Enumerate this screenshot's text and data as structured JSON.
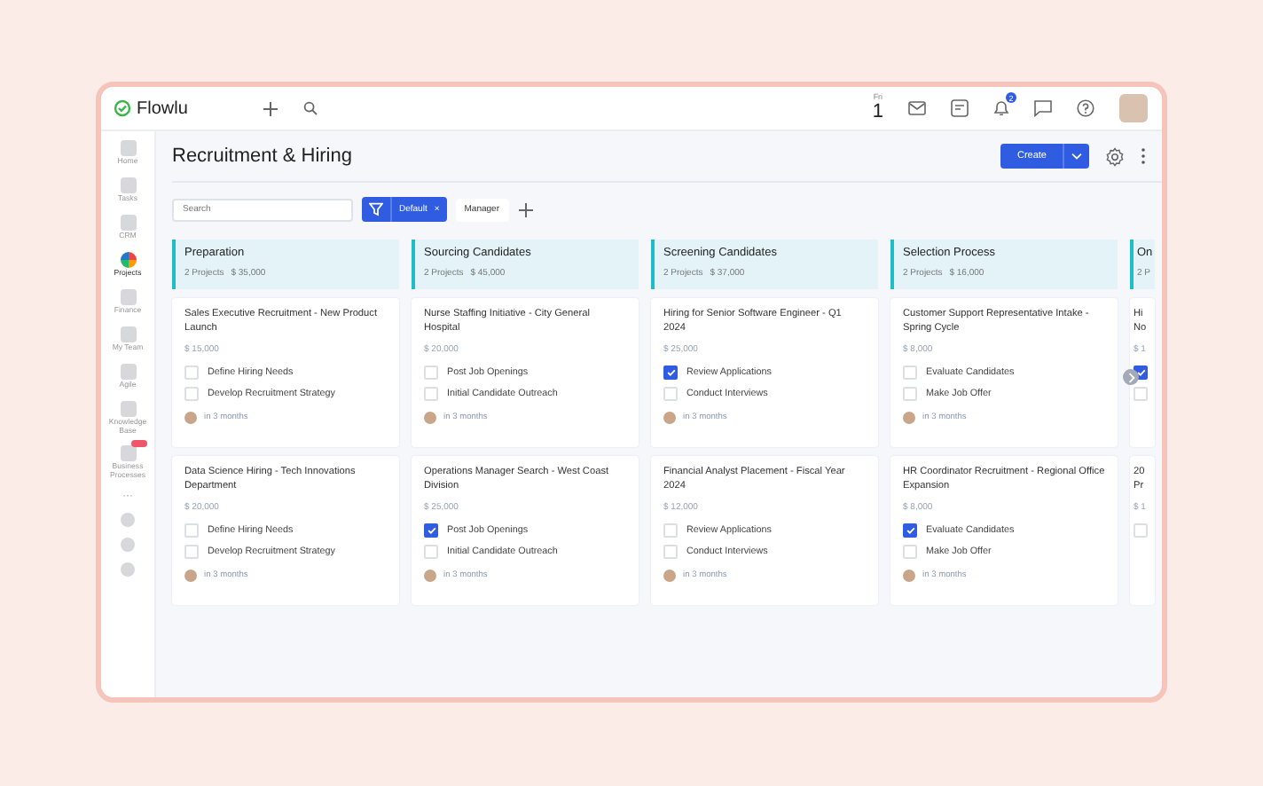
{
  "brand": {
    "name": "Flowlu"
  },
  "topbar": {
    "day": "Fri",
    "date": "1",
    "notifications": "2"
  },
  "sidebar": {
    "items": [
      {
        "label": "Home",
        "selected": false
      },
      {
        "label": "Tasks",
        "selected": false
      },
      {
        "label": "CRM",
        "selected": false
      },
      {
        "label": "Projects",
        "selected": true
      },
      {
        "label": "Finance",
        "selected": false
      },
      {
        "label": "My Team",
        "selected": false
      },
      {
        "label": "Agile",
        "selected": false
      },
      {
        "label": "Knowledge Base",
        "selected": false
      },
      {
        "label": "Business Processes",
        "selected": false
      }
    ],
    "more": "···"
  },
  "page": {
    "title": "Recruitment & Hiring",
    "create": "Create"
  },
  "filters": {
    "search_placeholder": "Search",
    "active_filter": "Default",
    "remove": "×",
    "chip": "Manager"
  },
  "columns": [
    {
      "title": "Preparation",
      "count": "2 Projects",
      "amount": "$ 35,000",
      "cards": [
        {
          "title": "Sales Executive Recruitment - New Product Launch",
          "amount": "$ 15,000",
          "tasks": [
            {
              "label": "Define Hiring Needs",
              "checked": false
            },
            {
              "label": "Develop Recruitment Strategy",
              "checked": false
            }
          ],
          "due": "in 3 months"
        },
        {
          "title": "Data Science Hiring - Tech Innovations Department",
          "amount": "$ 20,000",
          "tasks": [
            {
              "label": "Define Hiring Needs",
              "checked": false
            },
            {
              "label": "Develop Recruitment Strategy",
              "checked": false
            }
          ],
          "due": "in 3 months"
        }
      ]
    },
    {
      "title": "Sourcing Candidates",
      "count": "2 Projects",
      "amount": "$ 45,000",
      "cards": [
        {
          "title": "Nurse Staffing Initiative - City General Hospital",
          "amount": "$ 20,000",
          "tasks": [
            {
              "label": "Post Job Openings",
              "checked": false
            },
            {
              "label": "Initial Candidate Outreach",
              "checked": false
            }
          ],
          "due": "in 3 months"
        },
        {
          "title": "Operations Manager Search - West Coast Division",
          "amount": "$ 25,000",
          "tasks": [
            {
              "label": "Post Job Openings",
              "checked": true
            },
            {
              "label": "Initial Candidate Outreach",
              "checked": false
            }
          ],
          "due": "in 3 months"
        }
      ]
    },
    {
      "title": "Screening Candidates",
      "count": "2 Projects",
      "amount": "$ 37,000",
      "cards": [
        {
          "title": "Hiring for Senior Software Engineer - Q1 2024",
          "amount": "$ 25,000",
          "tasks": [
            {
              "label": "Review Applications",
              "checked": true
            },
            {
              "label": "Conduct Interviews",
              "checked": false
            }
          ],
          "due": "in 3 months"
        },
        {
          "title": "Financial Analyst Placement - Fiscal Year 2024",
          "amount": "$ 12,000",
          "tasks": [
            {
              "label": "Review Applications",
              "checked": false
            },
            {
              "label": "Conduct Interviews",
              "checked": false
            }
          ],
          "due": "in 3 months"
        }
      ]
    },
    {
      "title": "Selection Process",
      "count": "2 Projects",
      "amount": "$ 16,000",
      "cards": [
        {
          "title": "Customer Support Representative Intake - Spring Cycle",
          "amount": "$ 8,000",
          "tasks": [
            {
              "label": "Evaluate Candidates",
              "checked": false
            },
            {
              "label": "Make Job Offer",
              "checked": false
            }
          ],
          "due": "in 3 months"
        },
        {
          "title": "HR Coordinator Recruitment - Regional Office Expansion",
          "amount": "$ 8,000",
          "tasks": [
            {
              "label": "Evaluate Candidates",
              "checked": true
            },
            {
              "label": "Make Job Offer",
              "checked": false
            }
          ],
          "due": "in 3 months"
        }
      ]
    },
    {
      "title": "On",
      "count": "2 P",
      "cards": [
        {
          "title": "Hi No",
          "amount": "$ 1",
          "tasks": [
            {
              "checked": true
            },
            {
              "checked": false
            }
          ]
        },
        {
          "title": "20 Pr",
          "amount": "$ 1",
          "tasks": [
            {
              "checked": false
            }
          ]
        }
      ]
    }
  ]
}
